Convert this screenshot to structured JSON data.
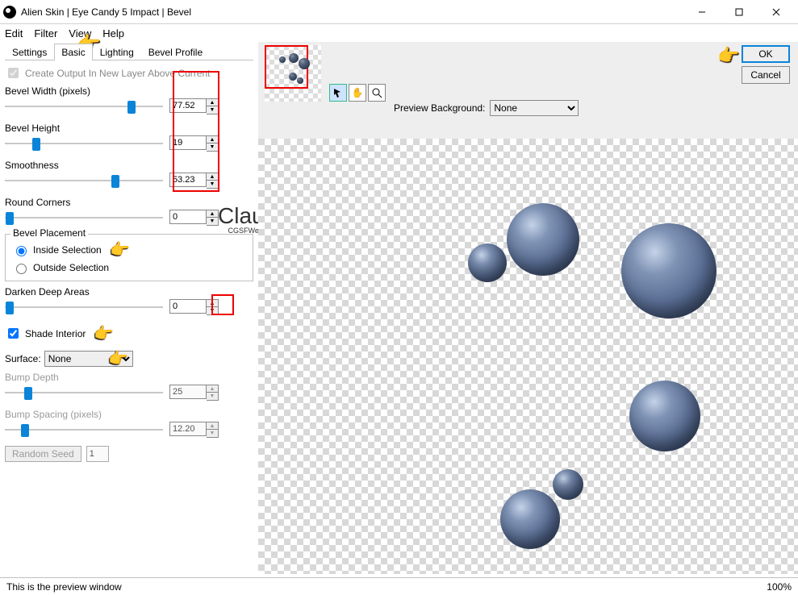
{
  "title": "Alien Skin | Eye Candy 5 Impact | Bevel",
  "menu": {
    "edit": "Edit",
    "filter": "Filter",
    "view": "View",
    "help": "Help"
  },
  "tabs": {
    "settings": "Settings",
    "basic": "Basic",
    "lighting": "Lighting",
    "bevel_profile": "Bevel Profile"
  },
  "create_output": "Create Output In New Layer Above Current",
  "fields": {
    "bevel_width": {
      "label": "Bevel Width (pixels)",
      "value": "77.52",
      "pos": 80
    },
    "bevel_height": {
      "label": "Bevel Height",
      "value": "19",
      "pos": 20
    },
    "smoothness": {
      "label": "Smoothness",
      "value": "53.23",
      "pos": 70
    },
    "round_corners": {
      "label": "Round Corners",
      "value": "0",
      "pos": 3
    },
    "darken": {
      "label": "Darken Deep Areas",
      "value": "0",
      "pos": 3
    },
    "bump_depth": {
      "label": "Bump Depth",
      "value": "25",
      "pos": 15
    },
    "bump_spacing": {
      "label": "Bump Spacing (pixels)",
      "value": "12.20",
      "pos": 13
    }
  },
  "placement": {
    "title": "Bevel Placement",
    "inside": "Inside Selection",
    "outside": "Outside Selection"
  },
  "shade_interior": "Shade Interior",
  "surface": {
    "label": "Surface:",
    "value": "None"
  },
  "random_seed": {
    "label": "Random Seed",
    "value": "1"
  },
  "preview_bg": {
    "label": "Preview Background:",
    "value": "None"
  },
  "buttons": {
    "ok": "OK",
    "cancel": "Cancel"
  },
  "status": {
    "text": "This is the preview window",
    "zoom": "100%"
  },
  "signature": "Claudia",
  "sig_sub": "CGSFWebdesign"
}
